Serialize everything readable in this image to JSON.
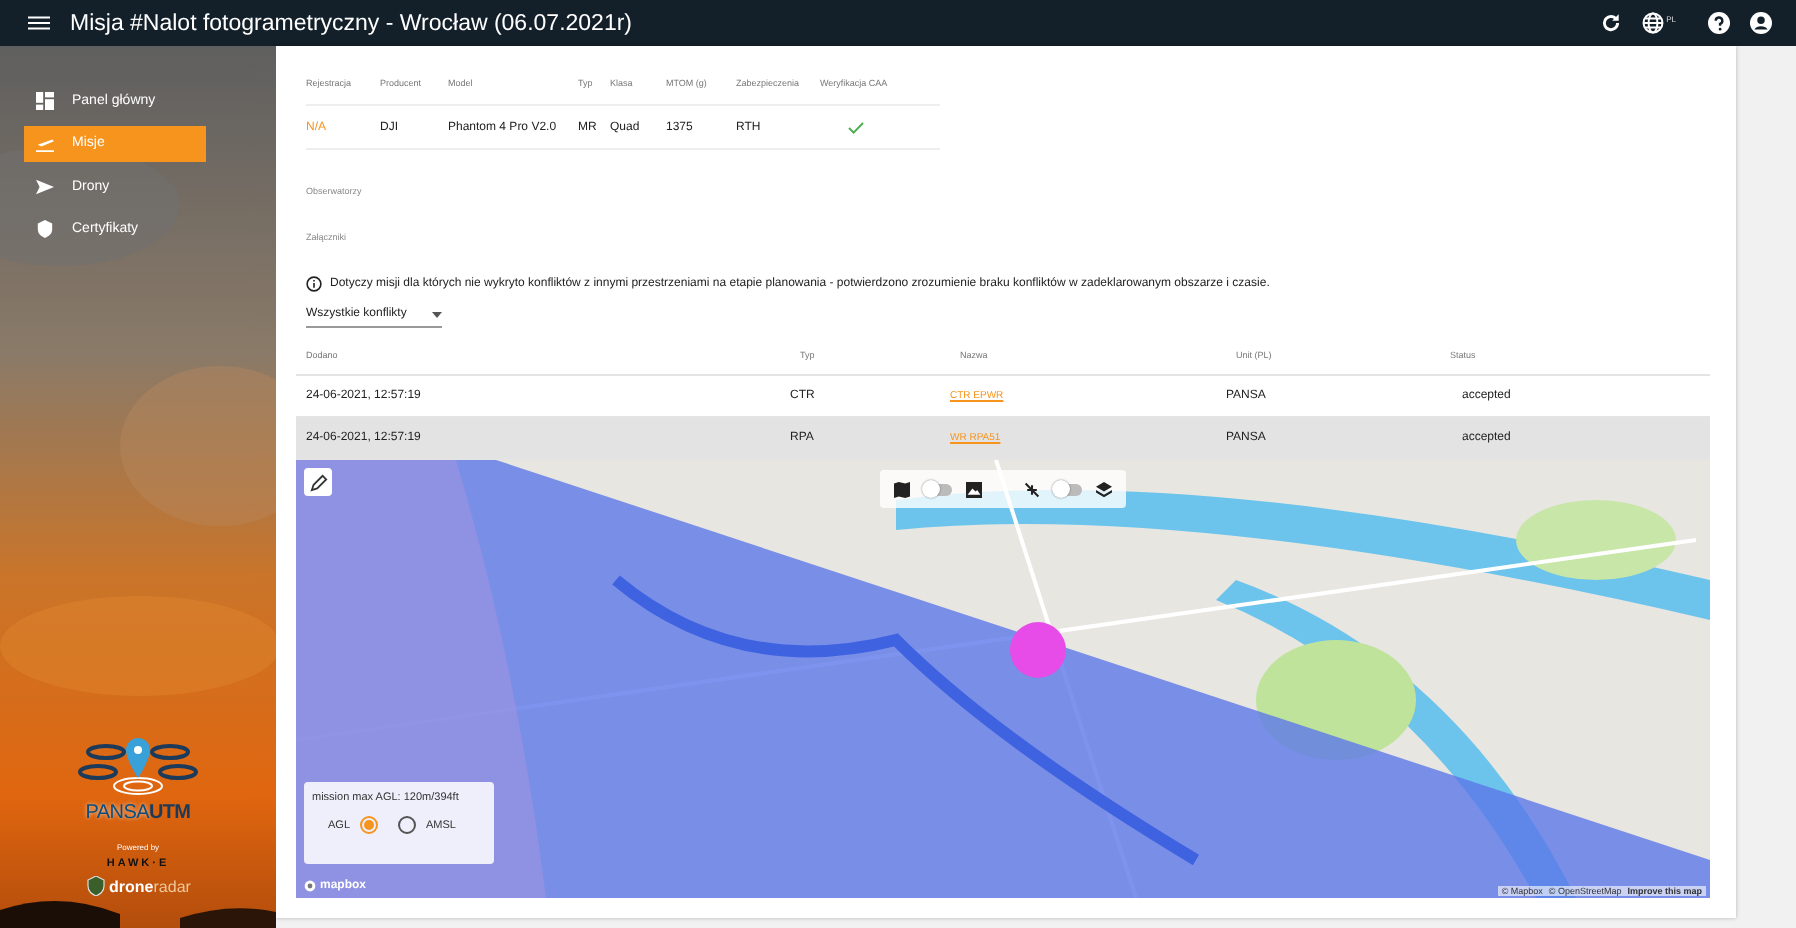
{
  "topbar": {
    "title": "Misja #Nalot fotogrametryczny - Wrocław (06.07.2021r)",
    "language": "PL"
  },
  "sidebar": {
    "items": [
      {
        "label": "Panel główny",
        "selected": false
      },
      {
        "label": "Misje",
        "selected": true
      },
      {
        "label": "Drony",
        "selected": false
      },
      {
        "label": "Certyfikaty",
        "selected": false
      }
    ],
    "brand": {
      "name": [
        "PANSA",
        "UTM"
      ],
      "powered": "Powered by",
      "partner": "HAWK·E",
      "drone_logo": [
        "drone",
        "radar"
      ]
    }
  },
  "drone_table": {
    "columns": [
      "Rejestracja",
      "Producent",
      "Model",
      "Typ",
      "Klasa",
      "MTOM (g)",
      "Zabezpieczenia",
      "Weryfikacja CAA"
    ],
    "rows": [
      {
        "cells": [
          "N/A",
          "DJI",
          "Phantom 4 Pro V2.0",
          "MR",
          "Quad",
          "1375",
          "RTH"
        ],
        "verified": true
      }
    ]
  },
  "sections": [
    "Obserwatorzy",
    "Załączniki"
  ],
  "notice": "Dotyczy misji dla których nie wykryto konfliktów z innymi przestrzeniami na etapie planowania - potwierdzono zrozumienie braku konfliktów w zadeklarowanym obszarze i czasie.",
  "filter": {
    "value": "Wszystkie konflikty"
  },
  "conflict_table": {
    "columns": [
      "Dodano",
      "Typ",
      "Nazwa",
      "Unit (PL)",
      "Status"
    ],
    "rows": [
      {
        "added": "24-06-2021, 12:57:19",
        "type": "CTR",
        "name": "CTR EPWR",
        "unit": "PANSA",
        "status": "accepted",
        "highlighted": false
      },
      {
        "added": "24-06-2021, 12:57:19",
        "type": "RPA",
        "name": "WR RPA51",
        "unit": "PANSA",
        "status": "accepted",
        "highlighted": true
      }
    ]
  },
  "map": {
    "toggles": [
      {
        "on": false
      },
      {
        "on": false
      }
    ],
    "legend": {
      "text": "mission max AGL: 120m/394ft",
      "options": [
        {
          "label": "AGL",
          "selected": true
        },
        {
          "label": "AMSL",
          "selected": false
        }
      ]
    },
    "logo": "mapbox",
    "attribution": [
      "© Mapbox",
      "© OpenStreetMap",
      "Improve this map"
    ]
  }
}
